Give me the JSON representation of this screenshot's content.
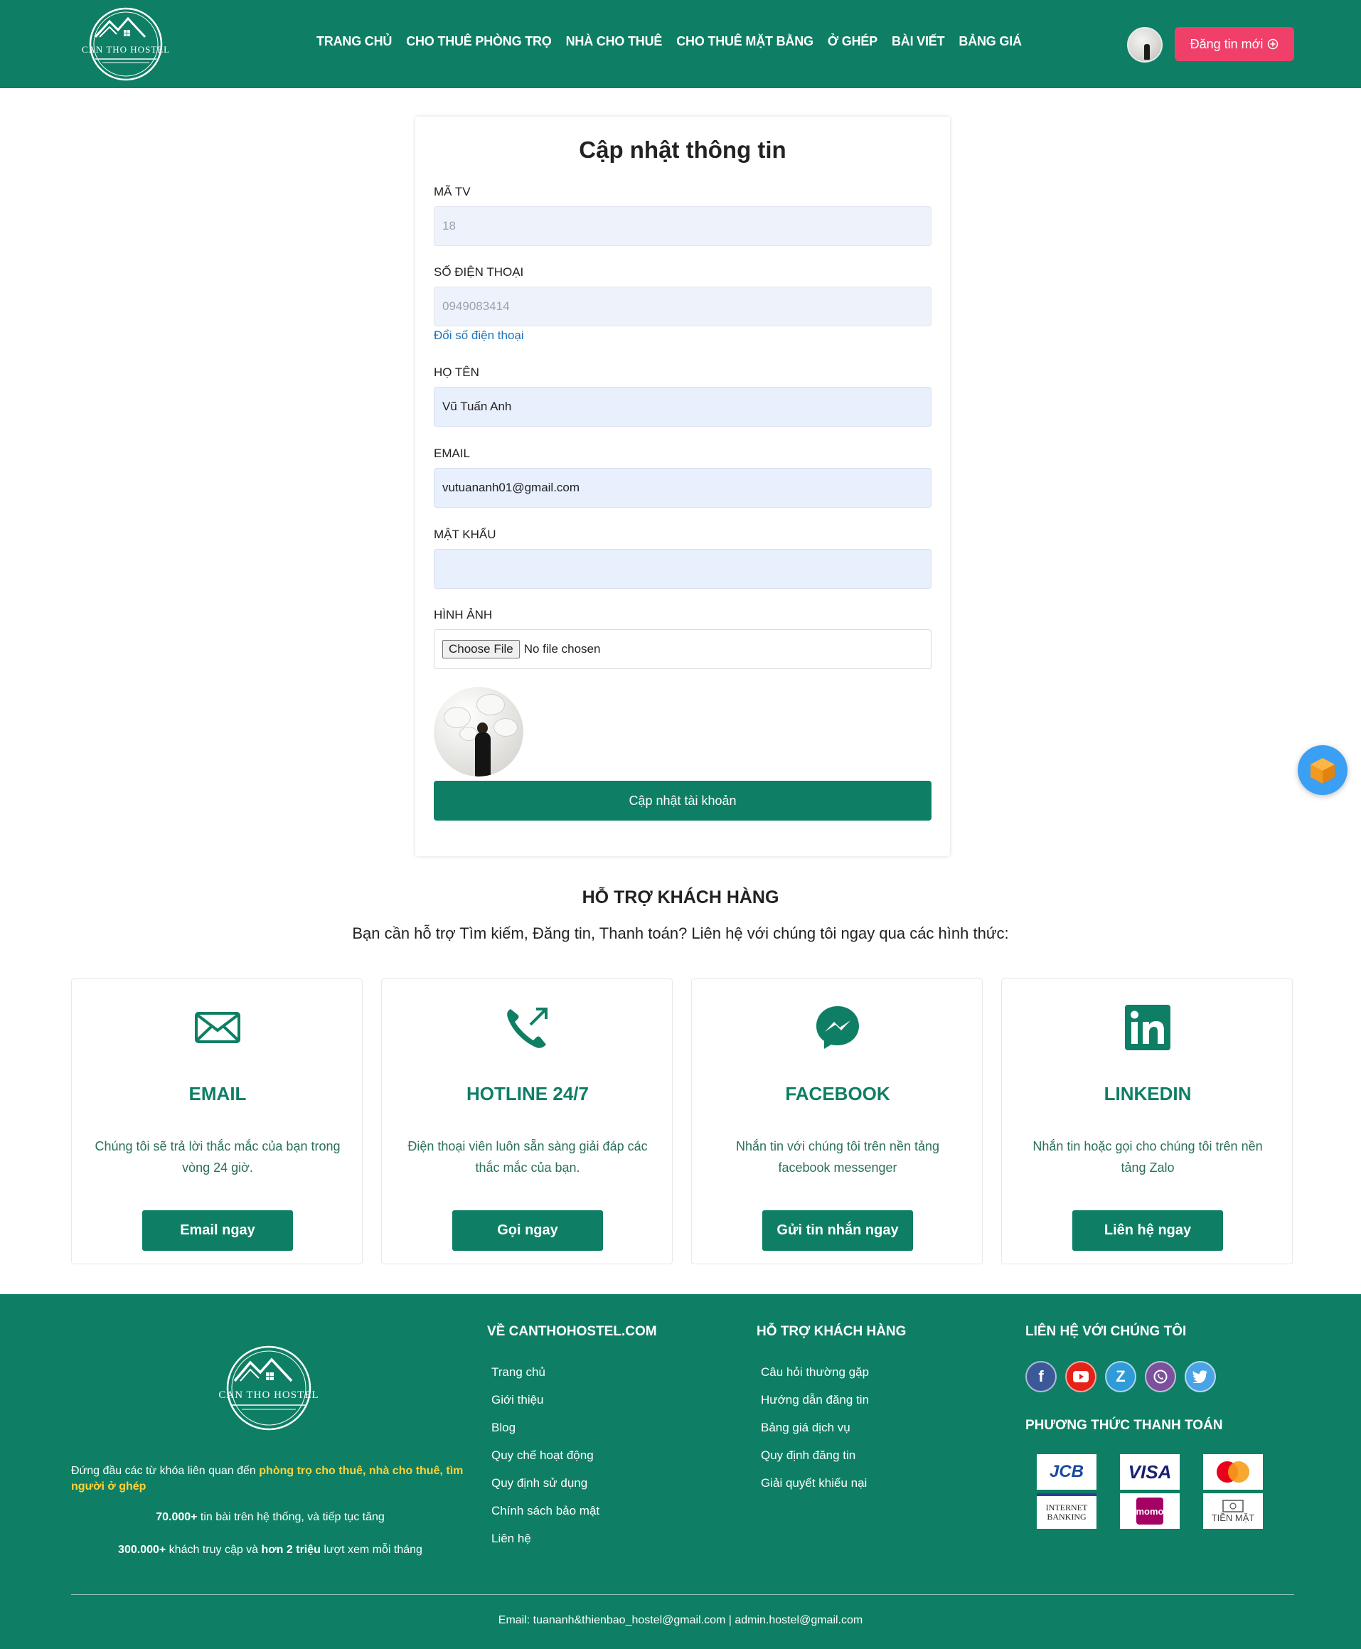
{
  "header": {
    "logo_text": "CAN THO HOSTEL",
    "nav": [
      "TRANG CHỦ",
      "CHO THUÊ PHÒNG TRỌ",
      "NHÀ CHO THUÊ",
      "CHO THUÊ MẶT BẰNG",
      "Ở GHÉP",
      "BÀI VIẾT",
      "BẢNG GIÁ"
    ],
    "post_button": "Đăng tin mới",
    "post_icon": "plus-circle-icon"
  },
  "form": {
    "title": "Cập nhật thông tin",
    "member_id": {
      "label": "MÃ TV",
      "value": "18"
    },
    "phone": {
      "label": "SỐ ĐIỆN THOẠI",
      "value": "0949083414",
      "change_link": "Đổi số điện thoại"
    },
    "name": {
      "label": "HỌ TÊN",
      "value": "Vũ Tuấn Anh"
    },
    "email": {
      "label": "EMAIL",
      "value": "vutuananh01@gmail.com"
    },
    "password": {
      "label": "MẬT KHẨU",
      "value": ""
    },
    "image": {
      "label": "HÌNH ẢNH",
      "button": "Choose File",
      "status": "No file chosen"
    },
    "submit": "Cập nhật tài khoản"
  },
  "support": {
    "title": "HỖ TRỢ KHÁCH HÀNG",
    "subtitle": "Bạn cần hỗ trợ Tìm kiếm, Đăng tin, Thanh toán? Liên hệ với chúng tôi ngay qua các hình thức:",
    "boxes": [
      {
        "icon": "envelope-icon",
        "title": "EMAIL",
        "text": "Chúng tôi sẽ trả lời thắc mắc của bạn trong vòng 24 giờ.",
        "button": "Email ngay"
      },
      {
        "icon": "phone-outgoing-icon",
        "title": "HOTLINE 24/7",
        "text": "Điện thoại viên luôn sẵn sàng giải đáp các thắc mắc của bạn.",
        "button": "Gọi ngay"
      },
      {
        "icon": "messenger-icon",
        "title": "FACEBOOK",
        "text": "Nhắn tin với chúng tôi trên nền tảng facebook messenger",
        "button": "Gửi tin nhắn ngay"
      },
      {
        "icon": "linkedin-icon",
        "title": "LINKEDIN",
        "text": "Nhắn tin hoặc gọi cho chúng tôi trên nền tảng Zalo",
        "button": "Liên hệ ngay"
      }
    ]
  },
  "footer": {
    "logo_text": "CAN THO HOSTEL",
    "desc_prefix": "Đứng đầu các từ khóa liên quan đến ",
    "desc_highlight_1": "phòng trọ cho thuê",
    "desc_sep_1": ", ",
    "desc_highlight_2": "nhà cho thuê",
    "desc_sep_2": ", ",
    "desc_highlight_3": "tìm người ở ghép",
    "stat1_bold": "70.000+",
    "stat1_text": " tin bài trên hệ thống, và tiếp tục tăng",
    "stat2_bold": "300.000+",
    "stat2_mid": " khách truy cập và ",
    "stat2_bold2": "hơn 2 triệu",
    "stat2_text": " lượt xem mỗi tháng",
    "col1_title": "VỀ CANTHOHOSTEL.COM",
    "col1_items": [
      "Trang chủ",
      "Giới thiệu",
      "Blog",
      "Quy chế hoạt động",
      "Quy định sử dụng",
      "Chính sách bảo mật",
      "Liên hệ"
    ],
    "col2_title": "HỖ TRỢ KHÁCH HÀNG",
    "col2_items": [
      "Câu hỏi thường gặp",
      "Hướng dẫn đăng tin",
      "Bảng giá dịch vụ",
      "Quy định đăng tin",
      "Giải quyết khiếu nại"
    ],
    "col3_title": "LIÊN HỆ VỚI CHÚNG TÔI",
    "social": [
      "facebook-icon",
      "youtube-icon",
      "zalo-icon",
      "viber-icon",
      "twitter-icon"
    ],
    "pay_title": "PHƯƠNG THỨC THANH TOÁN",
    "pay_methods": [
      "JCB",
      "VISA",
      "mastercard",
      "INTERNET BANKING",
      "momo",
      "TIỀN MẶT"
    ],
    "bottom": "Email: tuananh&thienbao_hostel@gmail.com | admin.hostel@gmail.com"
  },
  "colors": {
    "brand": "#0e7f64",
    "accent": "#f0406a",
    "highlight": "#ffd23a"
  }
}
